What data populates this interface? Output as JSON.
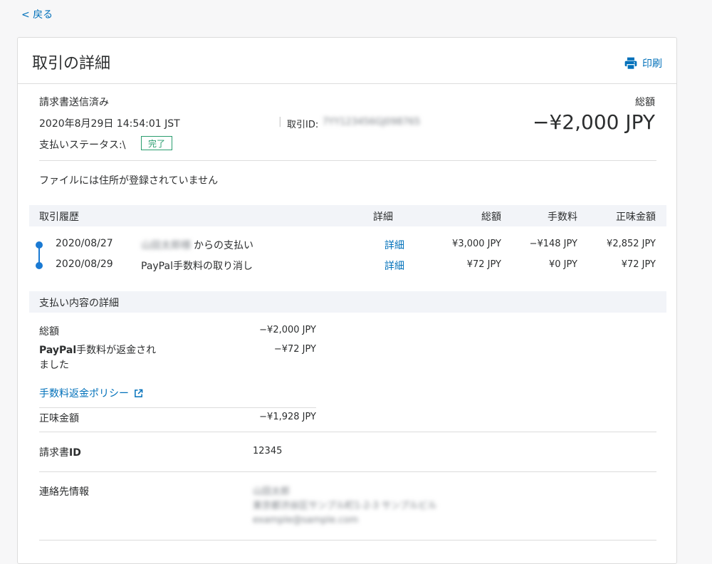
{
  "nav": {
    "back_label": "< 戻る"
  },
  "page": {
    "title": "取引の詳細",
    "print_label": "印刷"
  },
  "summary": {
    "status": "請求書送信済み",
    "datetime": "2020年8月29日 14:54:01 JST",
    "transaction_id_label": "取引ID:",
    "transaction_id_value": "7YY123456GJ098765",
    "payment_status_label": "支払いステータス:\\",
    "payment_status_badge": "完了",
    "total_label": "総額",
    "total_amount": "−¥2,000 JPY",
    "address_note": "ファイルには住所が登録されていません"
  },
  "history": {
    "headers": {
      "title": "取引履歴",
      "details": "詳細",
      "gross": "総額",
      "fee": "手数料",
      "net": "正味金額"
    },
    "rows": [
      {
        "date": "2020/08/27",
        "name": "山田太郎様",
        "desc": "からの支払い",
        "details": "詳細",
        "gross": "¥3,000 JPY",
        "fee": "−¥148 JPY",
        "net": "¥2,852 JPY"
      },
      {
        "date": "2020/08/29",
        "name": "",
        "desc": "PayPal手数料の取り消し",
        "details": "詳細",
        "gross": "¥72 JPY",
        "fee": "¥0 JPY",
        "net": "¥72 JPY"
      }
    ]
  },
  "payment_details": {
    "section_title": "支払い内容の詳細",
    "total_label": "総額",
    "total_value": "−¥2,000 JPY",
    "refund_bold": "PayPal",
    "refund_label_line1": "手数料が返金され",
    "refund_label_line2": "ました",
    "refund_value": "−¥72 JPY",
    "policy_link": "手数料返金ポリシー",
    "net_label": "正味金額",
    "net_value": "−¥1,928 JPY"
  },
  "invoice": {
    "label_prefix": "請求書",
    "label_bold": "ID",
    "value": "12345"
  },
  "contact": {
    "label": "連絡先情報",
    "line1": "山田太郎",
    "line2": "東京都渋谷区サンプル町1-2-3 サンプルビル",
    "line3": "example@sample.com"
  },
  "colors": {
    "link": "#0070ba",
    "badge": "#2a9d6f",
    "timeline": "#1a7ad3"
  }
}
